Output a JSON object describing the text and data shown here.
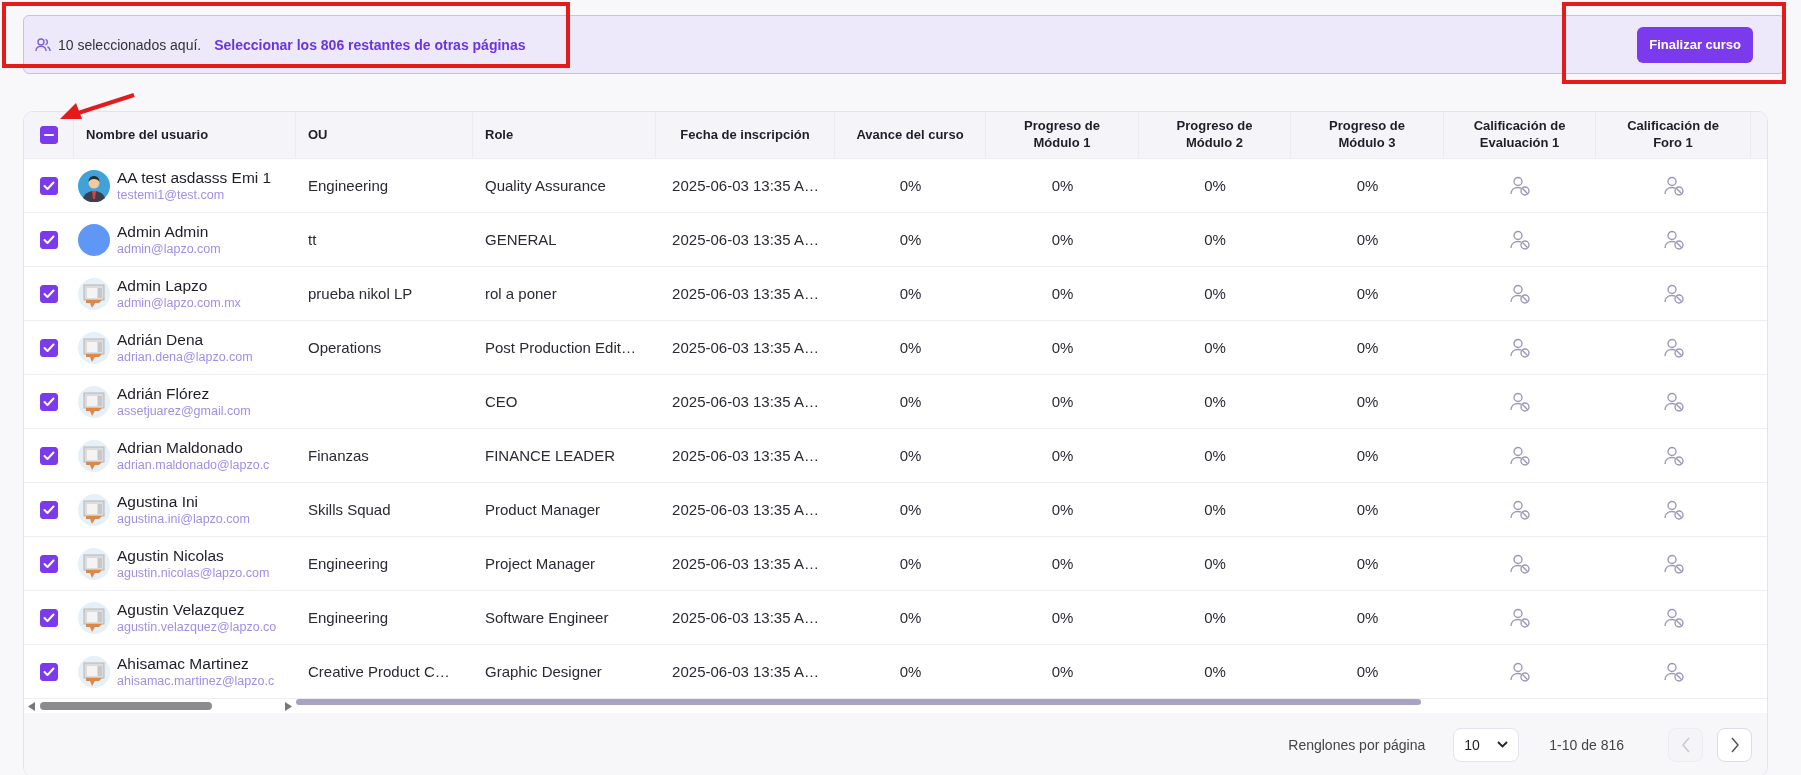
{
  "selection_banner": {
    "count_text": "10 seleccionados aquí.",
    "select_rest_link": "Seleccionar los 806 restantes de otras páginas",
    "action_button": "Finalizar curso"
  },
  "table": {
    "header_checkbox": {
      "indeterminate": true
    },
    "columns": [
      {
        "label": "Nombre del usuario"
      },
      {
        "label": "OU"
      },
      {
        "label": "Role"
      },
      {
        "label": "Fecha de inscripción"
      },
      {
        "label": "Avance del curso"
      },
      {
        "label": "Progreso de Módulo 1"
      },
      {
        "label": "Progreso de Módulo 2"
      },
      {
        "label": "Progreso de Módulo 3"
      },
      {
        "label": "Calificación de Evaluación 1"
      },
      {
        "label": "Calificación de Foro 1"
      }
    ],
    "rows": [
      {
        "checked": true,
        "avatar": {
          "kind": "person"
        },
        "name": "AA test asdasss Emi 1",
        "email": "testemi1@test.com",
        "ou": "Engineering",
        "role": "Quality Assurance",
        "date": "2025-06-03 13:35 A…",
        "course": "0%",
        "m1": "0%",
        "m2": "0%",
        "m3": "0%"
      },
      {
        "checked": true,
        "avatar": {
          "kind": "blank"
        },
        "name": "Admin Admin",
        "email": "admin@lapzo.com",
        "ou": "tt",
        "role": "GENERAL",
        "date": "2025-06-03 13:35 A…",
        "course": "0%",
        "m1": "0%",
        "m2": "0%",
        "m3": "0%"
      },
      {
        "checked": true,
        "avatar": {
          "kind": "building"
        },
        "name": "Admin Lapzo",
        "email": "admin@lapzo.com.mx",
        "ou": "prueba nikol LP",
        "role": "rol a poner",
        "date": "2025-06-03 13:35 A…",
        "course": "0%",
        "m1": "0%",
        "m2": "0%",
        "m3": "0%"
      },
      {
        "checked": true,
        "avatar": {
          "kind": "building"
        },
        "name": "Adrián Dena",
        "email": "adrian.dena@lapzo.com",
        "ou": "Operations",
        "role": "Post Production Edit…",
        "date": "2025-06-03 13:35 A…",
        "course": "0%",
        "m1": "0%",
        "m2": "0%",
        "m3": "0%"
      },
      {
        "checked": true,
        "avatar": {
          "kind": "building"
        },
        "name": "Adrián Flórez",
        "email": "assetjuarez@gmail.com",
        "ou": "",
        "role": "CEO",
        "date": "2025-06-03 13:35 A…",
        "course": "0%",
        "m1": "0%",
        "m2": "0%",
        "m3": "0%"
      },
      {
        "checked": true,
        "avatar": {
          "kind": "building"
        },
        "name": "Adrian Maldonado",
        "email": "adrian.maldonado@lapzo.c",
        "ou": "Finanzas",
        "role": "FINANCE LEADER",
        "date": "2025-06-03 13:35 A…",
        "course": "0%",
        "m1": "0%",
        "m2": "0%",
        "m3": "0%"
      },
      {
        "checked": true,
        "avatar": {
          "kind": "building"
        },
        "name": "Agustina Ini",
        "email": "agustina.ini@lapzo.com",
        "ou": "Skills Squad",
        "role": "Product Manager",
        "date": "2025-06-03 13:35 A…",
        "course": "0%",
        "m1": "0%",
        "m2": "0%",
        "m3": "0%"
      },
      {
        "checked": true,
        "avatar": {
          "kind": "building"
        },
        "name": "Agustin Nicolas",
        "email": "agustin.nicolas@lapzo.com",
        "ou": "Engineering",
        "role": "Project Manager",
        "date": "2025-06-03 13:35 A…",
        "course": "0%",
        "m1": "0%",
        "m2": "0%",
        "m3": "0%"
      },
      {
        "checked": true,
        "avatar": {
          "kind": "building"
        },
        "name": "Agustin Velazquez",
        "email": "agustin.velazquez@lapzo.co",
        "ou": "Engineering",
        "role": "Software Engineer",
        "date": "2025-06-03 13:35 A…",
        "course": "0%",
        "m1": "0%",
        "m2": "0%",
        "m3": "0%"
      },
      {
        "checked": true,
        "avatar": {
          "kind": "building"
        },
        "name": "Ahisamac Martinez",
        "email": "ahisamac.martinez@lapzo.c",
        "ou": "Creative Product C…",
        "role": "Graphic Designer",
        "date": "2025-06-03 13:35 A…",
        "course": "0%",
        "m1": "0%",
        "m2": "0%",
        "m3": "0%"
      }
    ]
  },
  "pagination": {
    "rows_per_page_label": "Renglones por página",
    "rows_per_page": "10",
    "range": "1-10 de 816",
    "previous_disabled": true,
    "next_disabled": false
  }
}
